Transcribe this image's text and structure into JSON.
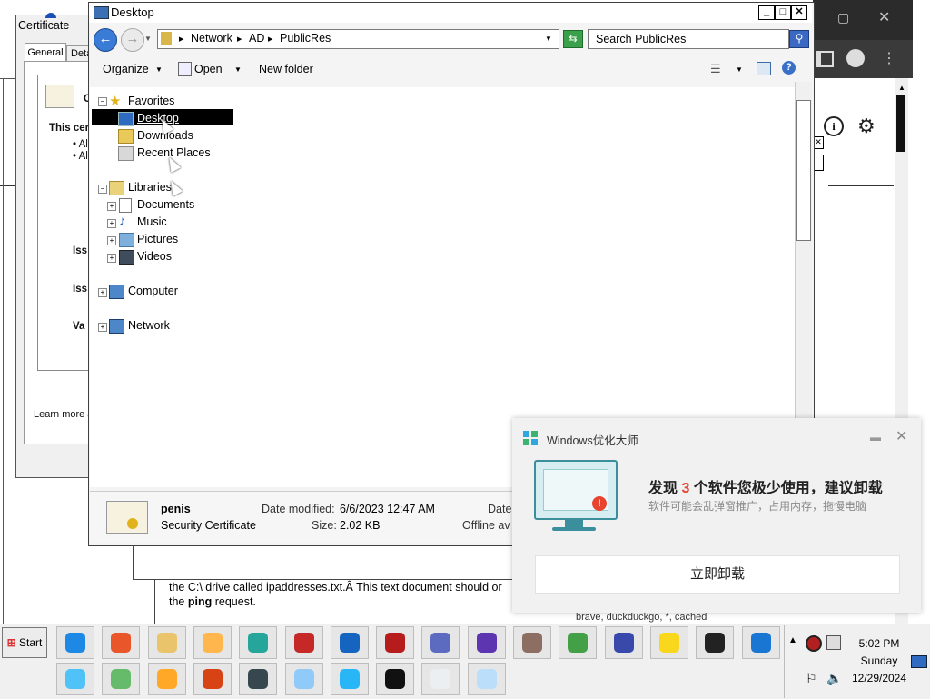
{
  "certificate": {
    "title": "Certificate",
    "tabs": [
      "General",
      "Details"
    ],
    "fragments": [
      "C",
      "This cer",
      "• Al",
      "• Al",
      "Iss",
      "Iss",
      "Va",
      "Learn more a"
    ]
  },
  "explorer": {
    "window_title": "Desktop",
    "breadcrumb": [
      "Network",
      "AD",
      "PublicRes"
    ],
    "search_placeholder": "Search PublicRes",
    "toolbar": {
      "organize": "Organize",
      "open": "Open",
      "new_folder": "New folder"
    },
    "nav": {
      "favorites": "Favorites",
      "desktop": "Desktop",
      "downloads": "Downloads",
      "recent": "Recent Places",
      "libraries": "Libraries",
      "documents": "Documents",
      "music": "Music",
      "pictures": "Pictures",
      "videos": "Videos",
      "computer": "Computer",
      "network": "Network"
    },
    "details": {
      "file_name": "penis",
      "file_type": "Security Certificate",
      "modified_label": "Date modified:",
      "modified_value": "6/6/2023 12:47 AM",
      "size_label": "Size:",
      "size_value": "2.02 KB",
      "date_cut": "Date",
      "offline_cut": "Offline av"
    }
  },
  "background_page": {
    "text_line1": "the C:\\ drive called ipaddresses.txt.Â This text document should or",
    "text_line2_pre": "the ",
    "text_line2_bold": "ping",
    "text_line2_post": " request.",
    "partial_text": "brave, duckduckgo, *, cached"
  },
  "popup": {
    "app_name": "Windows优化大师",
    "headline_pre": "发现 ",
    "headline_count": "3",
    "headline_post": " 个软件您极少使用，建议卸载",
    "subtitle": "软件可能会乱弹窗推广，占用内存，拖慢电脑",
    "button": "立即卸载",
    "accent": "#e8432e"
  },
  "taskbar": {
    "start_label": "Start",
    "apps_row1": [
      "internet-explorer",
      "firefox",
      "file-explorer",
      "media-player",
      "edge-beta",
      "davinci",
      "vpn-shield",
      "screen-recorder",
      "remote-desktop",
      "bird-app",
      "paint",
      "chrome",
      "infinity-app",
      "best-buy",
      "blackberry",
      "edge"
    ],
    "apps_row2": [
      "recycle-bin",
      "sandbox",
      "play-store",
      "flash",
      "tiles-app",
      "notepad-doc",
      "paper-plane",
      "command-prompt",
      "text-editor",
      "blank-document"
    ],
    "clock_time": "5:02 PM",
    "clock_day": "Sunday",
    "clock_date": "12/29/2024"
  }
}
